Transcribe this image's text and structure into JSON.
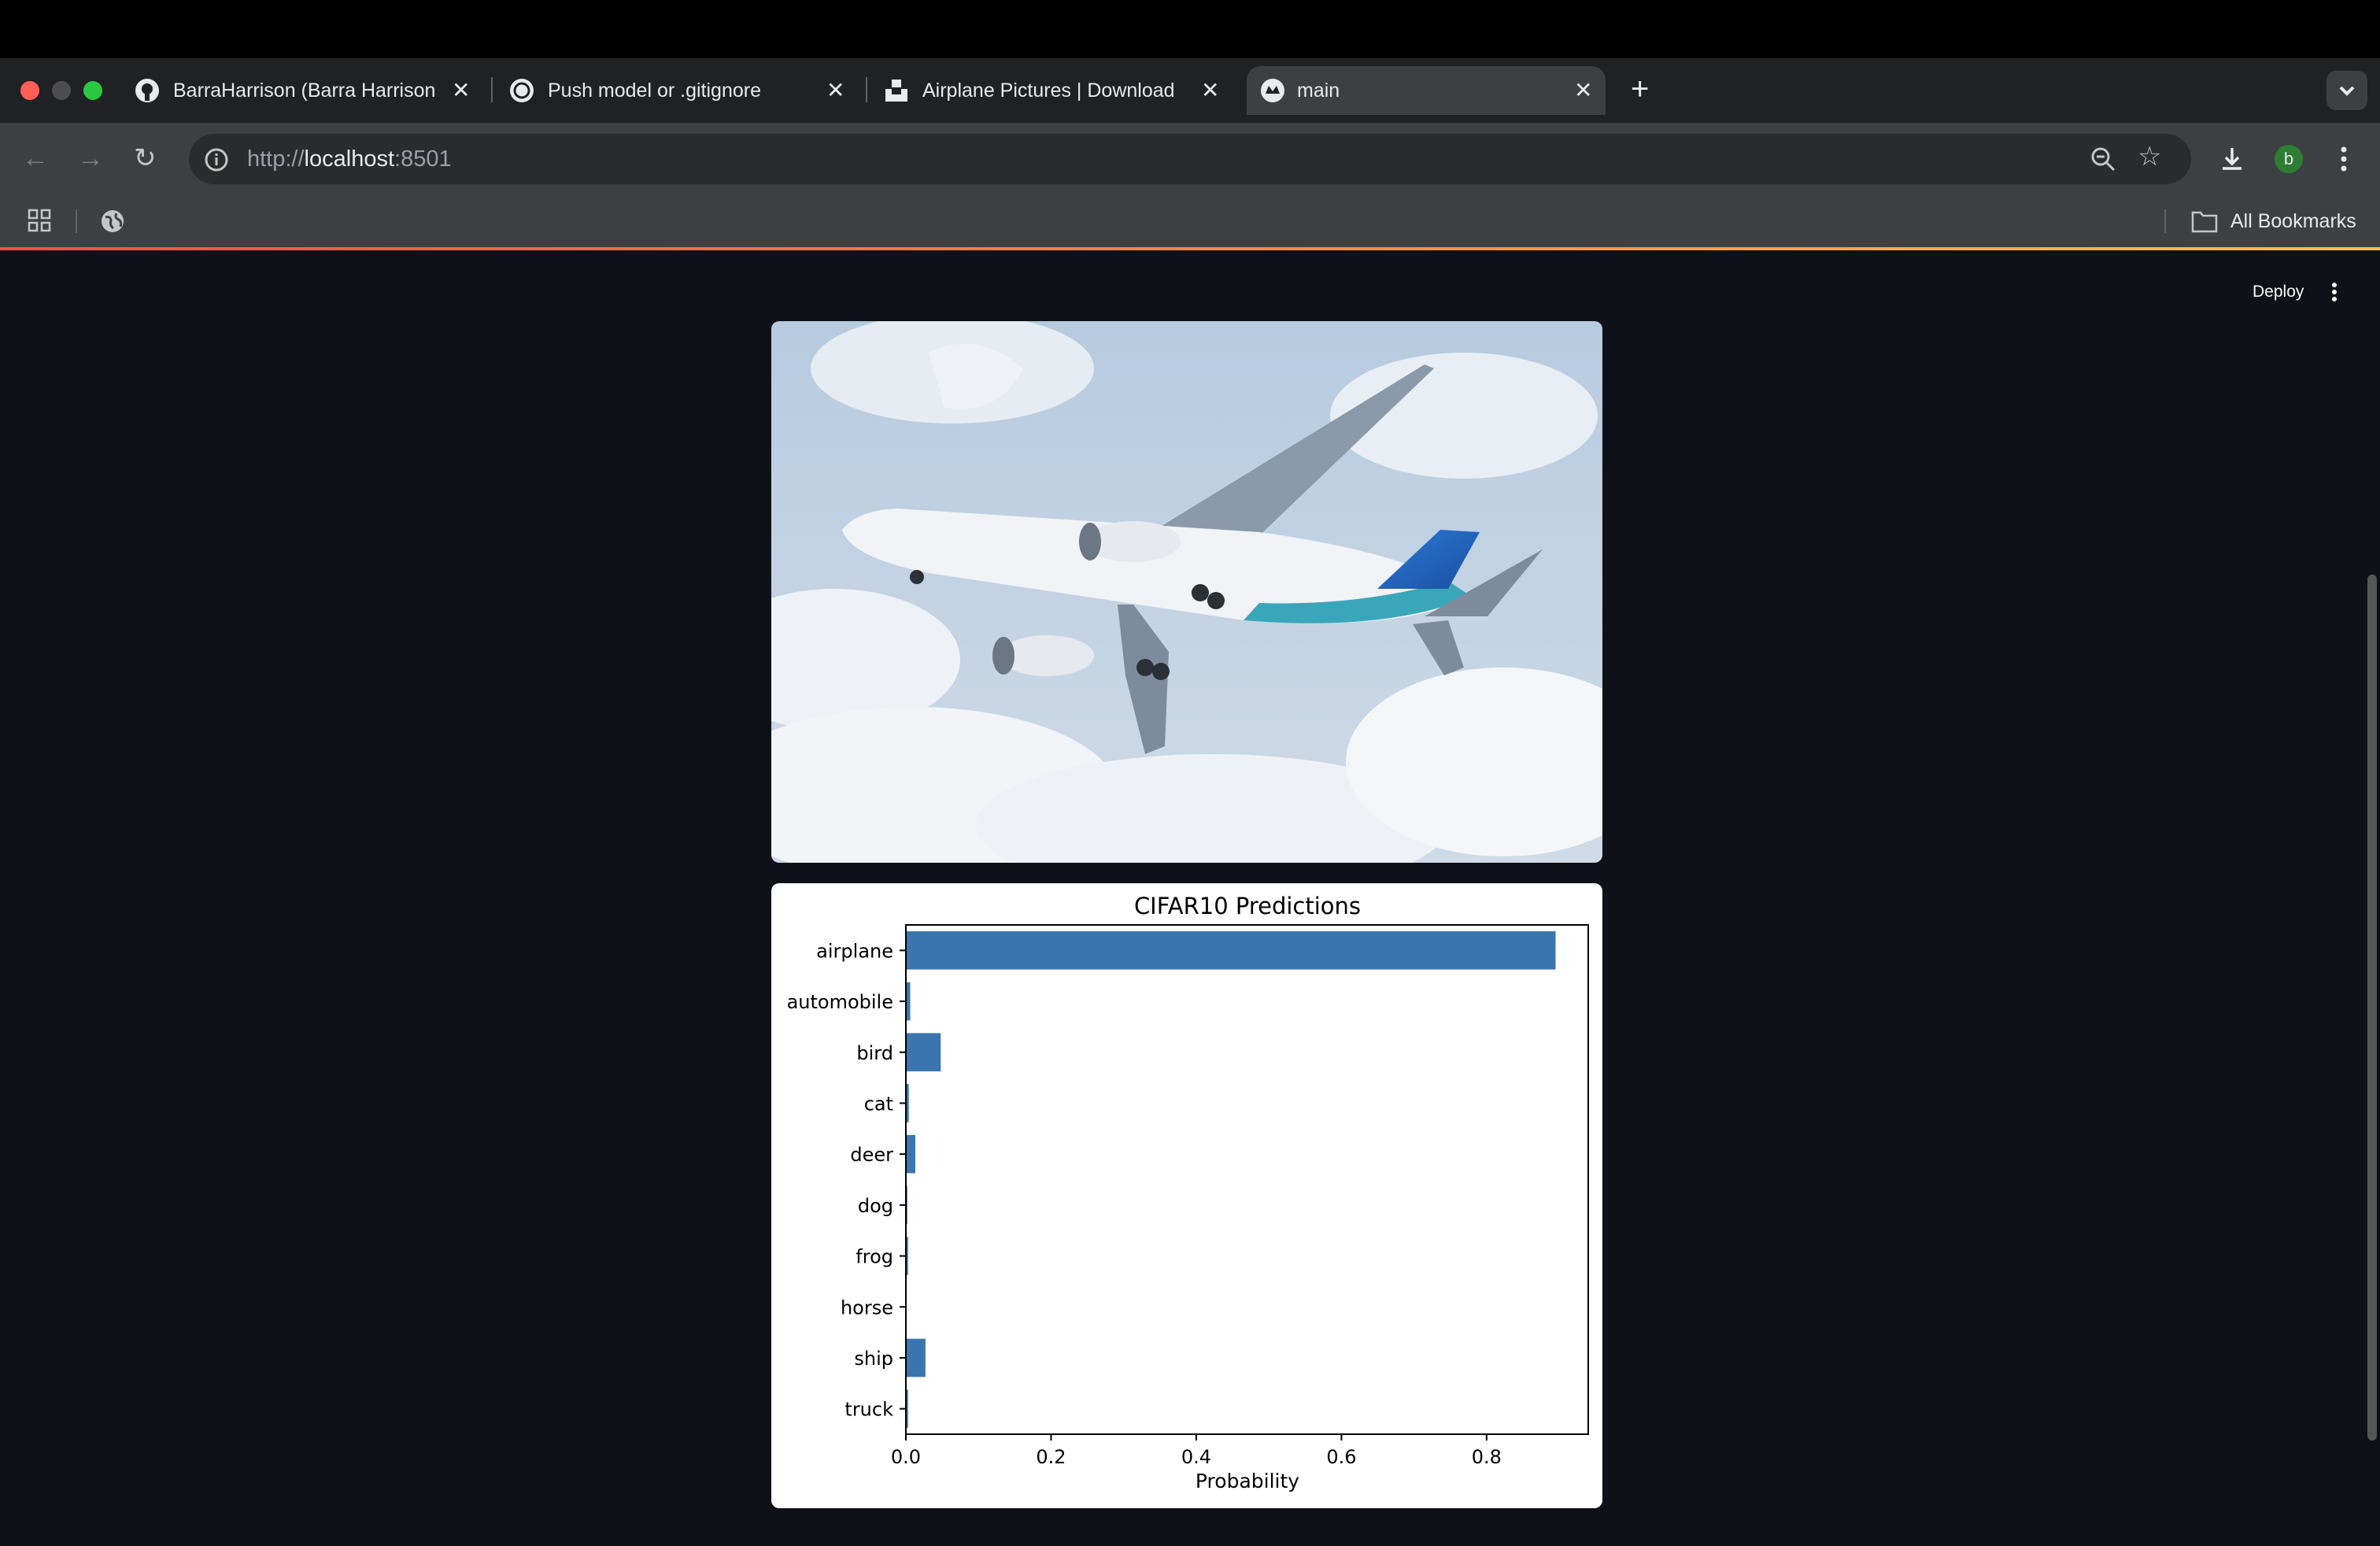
{
  "browser": {
    "tabs": [
      {
        "label": "BarraHarrison (Barra Harrison",
        "icon": "github-icon"
      },
      {
        "label": "Push model or .gitignore",
        "icon": "openai-icon"
      },
      {
        "label": "Airplane Pictures | Download",
        "icon": "unsplash-icon"
      },
      {
        "label": "main",
        "icon": "streamlit-icon",
        "active": true
      }
    ],
    "url_prefix": "http://",
    "url_host": "localhost",
    "url_port": ":8501",
    "profile_initial": "b",
    "bookmarks_label": "All Bookmarks"
  },
  "app": {
    "deploy_label": "Deploy",
    "image_alt": "airplane photo"
  },
  "colors": {
    "page_bg": "#0e1117",
    "bar": "#3a75b0",
    "profile": "#2e7d32"
  },
  "chart_data": {
    "type": "bar",
    "orientation": "horizontal",
    "title": "CIFAR10 Predictions",
    "xlabel": "Probability",
    "ylabel": "",
    "categories": [
      "airplane",
      "automobile",
      "bird",
      "cat",
      "deer",
      "dog",
      "frog",
      "horse",
      "ship",
      "truck"
    ],
    "values": [
      0.895,
      0.006,
      0.048,
      0.004,
      0.013,
      0.002,
      0.003,
      0.001,
      0.027,
      0.003
    ],
    "xlim": [
      0,
      0.94
    ],
    "xticks": [
      0.0,
      0.2,
      0.4,
      0.6,
      0.8
    ],
    "xtick_labels": [
      "0.0",
      "0.2",
      "0.4",
      "0.6",
      "0.8"
    ],
    "grid": false
  }
}
